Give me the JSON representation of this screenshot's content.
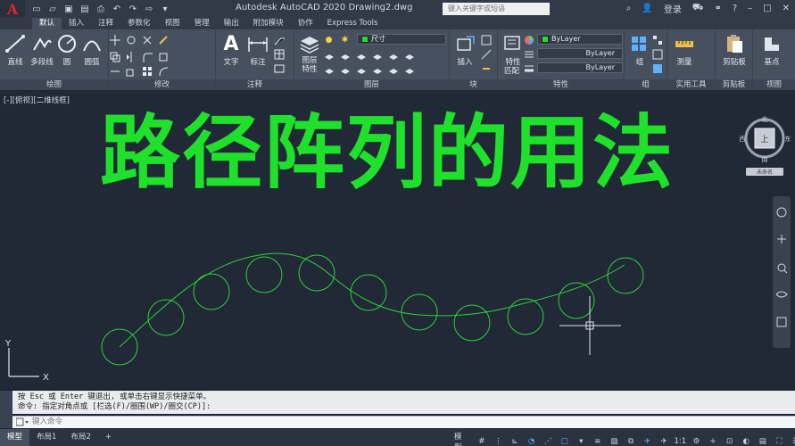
{
  "titlebar": {
    "app_letter": "A",
    "title": "Autodesk AutoCAD 2020    Drawing2.dwg",
    "search_placeholder": "键入关键字或短语",
    "user": "登录"
  },
  "ribbon_tabs": [
    "默认",
    "插入",
    "注释",
    "参数化",
    "视图",
    "管理",
    "输出",
    "附加模块",
    "协作",
    "Express Tools"
  ],
  "ribbon": {
    "draw": {
      "label": "绘图",
      "tools": [
        "直线",
        "多段线",
        "圆",
        "圆弧"
      ]
    },
    "modify": {
      "label": "修改"
    },
    "annotation": {
      "label": "注释",
      "tools": [
        "文字",
        "标注"
      ]
    },
    "layers": {
      "label": "图层",
      "tool": "图层\n特性",
      "dropdown": "尺寸"
    },
    "block": {
      "label": "块",
      "tool": "插入"
    },
    "properties": {
      "label": "特性",
      "tools": [
        "特性",
        "匹配"
      ],
      "bylayer": [
        "ByLayer",
        "ByLayer",
        "ByLayer"
      ]
    },
    "groups": {
      "label": "组",
      "tool": "组"
    },
    "utilities": {
      "label": "实用工具",
      "tool": "测量"
    },
    "clipboard": {
      "label": "剪贴板",
      "tool": "剪贴板"
    },
    "view": {
      "label": "视图",
      "tool": "基点"
    }
  },
  "drawing": {
    "viewport_label": "[-][俯视][二维线框]",
    "banner": "路径阵列的用法",
    "path_color": "#2fd13a",
    "viewcube": {
      "north": "北",
      "south": "南",
      "east": "东",
      "west": "西",
      "top": "上",
      "wcs": "未命名"
    },
    "ucs": {
      "x": "X",
      "y": "Y"
    }
  },
  "command": {
    "history": [
      "按 Esc 或 Enter 键退出, 或单击右键显示快捷菜单。",
      "命令: 指定对角点或 [栏选(F)/圈围(WP)/圈交(CP)]:"
    ],
    "input_placeholder": "键入命令"
  },
  "status": {
    "layout_tabs": [
      "模型",
      "布局1",
      "布局2",
      "+"
    ],
    "model": "模型",
    "scale": "1:1"
  }
}
